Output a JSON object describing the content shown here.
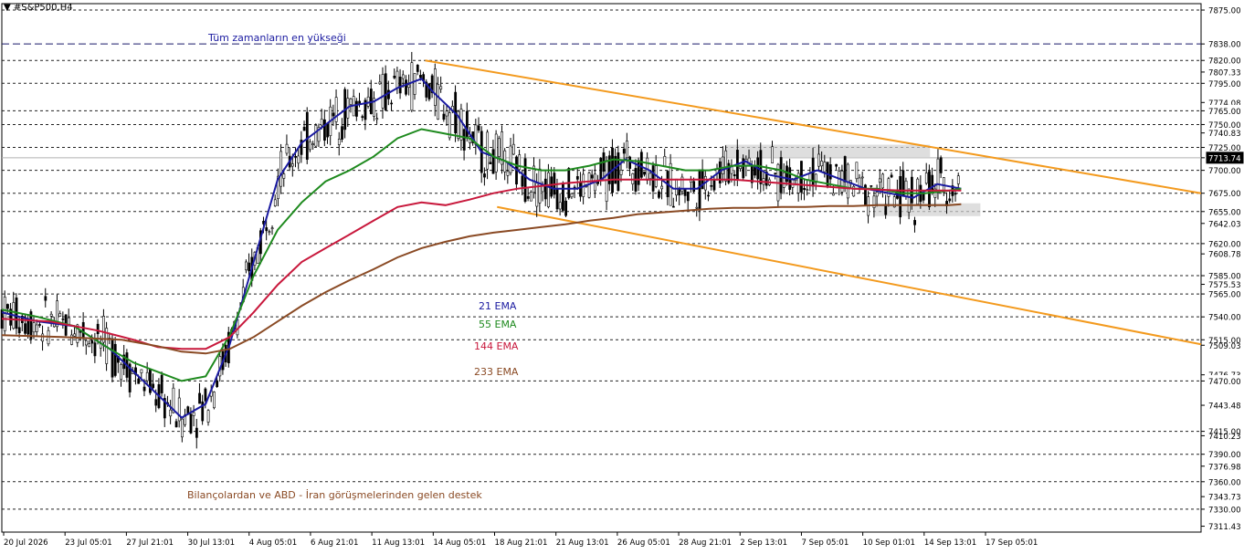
{
  "symbol": "#S&P500,H4",
  "chart_data": {
    "type": "candlestick",
    "title": "#S&P500,H4",
    "ylim": [
      7305,
      7882
    ],
    "y_ticks": [
      "7875.00",
      "7838.00",
      "7820.00",
      "7807.33",
      "7795.00",
      "7774.08",
      "7765.00",
      "7750.00",
      "7740.83",
      "7725.00",
      "7713.74",
      "7700.00",
      "7675.00",
      "7655.00",
      "7642.03",
      "7620.00",
      "7608.78",
      "7585.00",
      "7575.53",
      "7565.00",
      "7540.00",
      "7515.00",
      "7509.03",
      "7476.73",
      "7470.00",
      "7443.48",
      "7415.00",
      "7410.23",
      "7390.00",
      "7376.98",
      "7360.00",
      "7343.73",
      "7330.00",
      "7311.43"
    ],
    "x_ticks": [
      "20 Jul 2026",
      "23 Jul 05:01",
      "27 Jul 21:01",
      "30 Jul 13:01",
      "4 Aug 05:01",
      "6 Aug 21:01",
      "11 Aug 13:01",
      "14 Aug 05:01",
      "18 Aug 21:01",
      "21 Aug 13:01",
      "26 Aug 05:01",
      "28 Aug 21:01",
      "2 Sep 13:01",
      "7 Sep 05:01",
      "10 Sep 01:01",
      "14 Sep 13:01",
      "17 Sep 05:01"
    ],
    "current_price": "7713.74",
    "horizontal_levels": [
      7875,
      7838,
      7820,
      7795,
      7765,
      7750,
      7725,
      7700,
      7675,
      7655,
      7620,
      7585,
      7565,
      7540,
      7515,
      7470,
      7415,
      7390,
      7360,
      7330
    ],
    "all_time_high_level": 7838,
    "channel": {
      "upper": [
        [
          0.353,
          7820
        ],
        [
          1.0,
          7675
        ]
      ],
      "lower": [
        [
          0.413,
          7660
        ],
        [
          1.0,
          7510
        ]
      ]
    },
    "resistance_zone": [
      7713,
      7728
    ],
    "support_zone": [
      7650,
      7664
    ],
    "series": [
      {
        "name": "21 EMA",
        "color": "#1a1aa0",
        "values": [
          [
            0,
            7545
          ],
          [
            0.03,
            7535
          ],
          [
            0.06,
            7530
          ],
          [
            0.09,
            7505
          ],
          [
            0.11,
            7480
          ],
          [
            0.13,
            7455
          ],
          [
            0.15,
            7430
          ],
          [
            0.17,
            7445
          ],
          [
            0.19,
            7510
          ],
          [
            0.21,
            7600
          ],
          [
            0.23,
            7690
          ],
          [
            0.25,
            7730
          ],
          [
            0.27,
            7750
          ],
          [
            0.29,
            7770
          ],
          [
            0.31,
            7775
          ],
          [
            0.33,
            7790
          ],
          [
            0.35,
            7800
          ],
          [
            0.36,
            7785
          ],
          [
            0.38,
            7760
          ],
          [
            0.4,
            7720
          ],
          [
            0.42,
            7710
          ],
          [
            0.44,
            7690
          ],
          [
            0.46,
            7680
          ],
          [
            0.48,
            7680
          ],
          [
            0.5,
            7690
          ],
          [
            0.52,
            7712
          ],
          [
            0.54,
            7700
          ],
          [
            0.56,
            7680
          ],
          [
            0.58,
            7680
          ],
          [
            0.6,
            7700
          ],
          [
            0.62,
            7710
          ],
          [
            0.64,
            7695
          ],
          [
            0.66,
            7690
          ],
          [
            0.68,
            7700
          ],
          [
            0.7,
            7690
          ],
          [
            0.72,
            7680
          ],
          [
            0.74,
            7675
          ],
          [
            0.76,
            7670
          ],
          [
            0.78,
            7685
          ],
          [
            0.8,
            7680
          ]
        ]
      },
      {
        "name": "55 EMA",
        "color": "#1e8a1e",
        "values": [
          [
            0,
            7548
          ],
          [
            0.03,
            7540
          ],
          [
            0.06,
            7530
          ],
          [
            0.09,
            7505
          ],
          [
            0.11,
            7490
          ],
          [
            0.13,
            7480
          ],
          [
            0.15,
            7470
          ],
          [
            0.17,
            7475
          ],
          [
            0.19,
            7520
          ],
          [
            0.21,
            7585
          ],
          [
            0.23,
            7635
          ],
          [
            0.25,
            7665
          ],
          [
            0.27,
            7688
          ],
          [
            0.29,
            7700
          ],
          [
            0.31,
            7715
          ],
          [
            0.33,
            7735
          ],
          [
            0.35,
            7745
          ],
          [
            0.37,
            7740
          ],
          [
            0.39,
            7735
          ],
          [
            0.41,
            7715
          ],
          [
            0.43,
            7705
          ],
          [
            0.45,
            7700
          ],
          [
            0.47,
            7700
          ],
          [
            0.49,
            7705
          ],
          [
            0.51,
            7712
          ],
          [
            0.53,
            7710
          ],
          [
            0.55,
            7705
          ],
          [
            0.57,
            7700
          ],
          [
            0.59,
            7700
          ],
          [
            0.61,
            7705
          ],
          [
            0.63,
            7705
          ],
          [
            0.65,
            7700
          ],
          [
            0.67,
            7690
          ],
          [
            0.69,
            7685
          ],
          [
            0.71,
            7680
          ],
          [
            0.73,
            7680
          ],
          [
            0.75,
            7675
          ],
          [
            0.77,
            7675
          ],
          [
            0.79,
            7678
          ],
          [
            0.8,
            7680
          ]
        ]
      },
      {
        "name": "144 EMA",
        "color": "#c8183c",
        "values": [
          [
            0,
            7538
          ],
          [
            0.04,
            7535
          ],
          [
            0.08,
            7525
          ],
          [
            0.11,
            7515
          ],
          [
            0.13,
            7507
          ],
          [
            0.15,
            7505
          ],
          [
            0.17,
            7505
          ],
          [
            0.19,
            7518
          ],
          [
            0.21,
            7545
          ],
          [
            0.23,
            7575
          ],
          [
            0.25,
            7600
          ],
          [
            0.27,
            7615
          ],
          [
            0.29,
            7630
          ],
          [
            0.31,
            7645
          ],
          [
            0.33,
            7660
          ],
          [
            0.35,
            7665
          ],
          [
            0.37,
            7662
          ],
          [
            0.39,
            7668
          ],
          [
            0.41,
            7675
          ],
          [
            0.43,
            7680
          ],
          [
            0.45,
            7683
          ],
          [
            0.47,
            7686
          ],
          [
            0.49,
            7688
          ],
          [
            0.51,
            7690
          ],
          [
            0.53,
            7690
          ],
          [
            0.55,
            7690
          ],
          [
            0.57,
            7690
          ],
          [
            0.59,
            7690
          ],
          [
            0.61,
            7690
          ],
          [
            0.63,
            7688
          ],
          [
            0.65,
            7686
          ],
          [
            0.67,
            7684
          ],
          [
            0.69,
            7682
          ],
          [
            0.71,
            7680
          ],
          [
            0.73,
            7679
          ],
          [
            0.75,
            7678
          ],
          [
            0.77,
            7678
          ],
          [
            0.79,
            7678
          ],
          [
            0.8,
            7678
          ]
        ]
      },
      {
        "name": "233 EMA",
        "color": "#8a4a24",
        "values": [
          [
            0,
            7520
          ],
          [
            0.05,
            7518
          ],
          [
            0.1,
            7515
          ],
          [
            0.13,
            7508
          ],
          [
            0.15,
            7502
          ],
          [
            0.17,
            7500
          ],
          [
            0.19,
            7505
          ],
          [
            0.21,
            7518
          ],
          [
            0.23,
            7535
          ],
          [
            0.25,
            7552
          ],
          [
            0.27,
            7567
          ],
          [
            0.29,
            7580
          ],
          [
            0.31,
            7592
          ],
          [
            0.33,
            7605
          ],
          [
            0.35,
            7615
          ],
          [
            0.37,
            7622
          ],
          [
            0.39,
            7628
          ],
          [
            0.41,
            7632
          ],
          [
            0.43,
            7635
          ],
          [
            0.45,
            7638
          ],
          [
            0.47,
            7641
          ],
          [
            0.49,
            7645
          ],
          [
            0.51,
            7648
          ],
          [
            0.53,
            7652
          ],
          [
            0.55,
            7654
          ],
          [
            0.57,
            7656
          ],
          [
            0.59,
            7658
          ],
          [
            0.61,
            7659
          ],
          [
            0.63,
            7659
          ],
          [
            0.65,
            7660
          ],
          [
            0.67,
            7660
          ],
          [
            0.69,
            7661
          ],
          [
            0.71,
            7661
          ],
          [
            0.73,
            7662
          ],
          [
            0.75,
            7662
          ],
          [
            0.77,
            7662
          ],
          [
            0.79,
            7662
          ],
          [
            0.8,
            7663
          ]
        ]
      }
    ],
    "annotations": [
      {
        "text": "Tüm zamanların en yükseği",
        "color": "#1a1aa0"
      },
      {
        "text": "21 EMA",
        "color": "#1a1aa0"
      },
      {
        "text": "55 EMA",
        "color": "#1e8a1e"
      },
      {
        "text": "144 EMA",
        "color": "#c8183c"
      },
      {
        "text": "233 EMA",
        "color": "#8a4a24"
      },
      {
        "text": "Bilançolardan ve ABD - İran görüşmelerinden gelen destek",
        "color": "#8a4a24"
      }
    ]
  }
}
